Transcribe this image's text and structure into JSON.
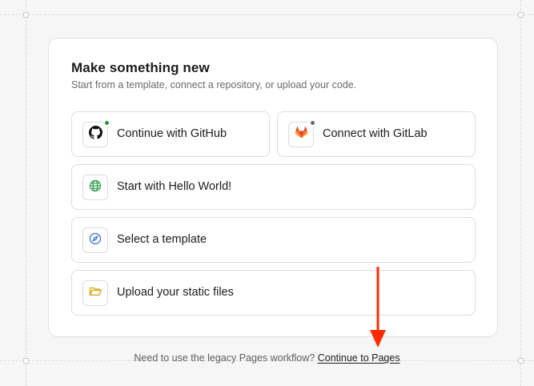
{
  "header": {
    "title": "Make something new",
    "subtitle": "Start from a template, connect a repository, or upload your code."
  },
  "options": {
    "github": {
      "label": "Continue with GitHub",
      "icon": "github-icon",
      "status_color": "#1f9d41"
    },
    "gitlab": {
      "label": "Connect with GitLab",
      "icon": "gitlab-icon",
      "status_color": "#6b6b6b"
    },
    "hello_world": {
      "label": "Start with Hello World!",
      "icon": "globe-icon"
    },
    "template": {
      "label": "Select a template",
      "icon": "compass-icon"
    },
    "upload": {
      "label": "Upload your static files",
      "icon": "folder-icon"
    }
  },
  "footer": {
    "prompt": "Need to use the legacy Pages workflow?",
    "link": "Continue to Pages"
  },
  "colors": {
    "annotation_arrow": "#ff2a00",
    "globe": "#2a9d4b",
    "compass": "#3a6fe0",
    "folder": "#e0a100",
    "gitlab": "#e24329"
  }
}
